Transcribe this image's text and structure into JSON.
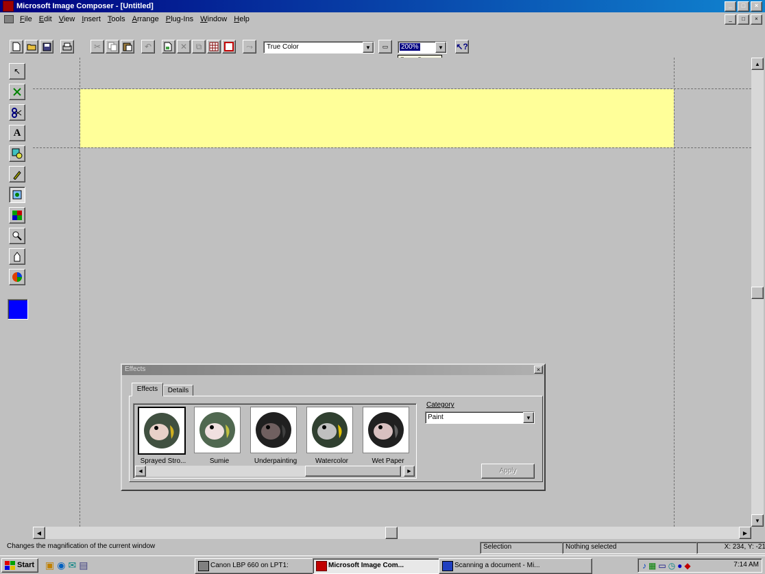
{
  "window": {
    "title": "Microsoft Image Composer - [Untitled]",
    "caption_buttons": [
      "_",
      "□",
      "×"
    ]
  },
  "menu": [
    "File",
    "Edit",
    "View",
    "Insert",
    "Tools",
    "Arrange",
    "Plug-Ins",
    "Window",
    "Help"
  ],
  "toolbar": {
    "color_format": "True Color",
    "zoom_value": "200%",
    "zoom_tooltip": "Zoom Percent"
  },
  "toolbox": {
    "tools": [
      "arrow-icon",
      "arrange-icon",
      "cutout-icon",
      "text-icon",
      "shapes-icon",
      "paint-icon",
      "effects-icon",
      "texture-icon",
      "zoom-icon",
      "pan-icon",
      "color-tuning-icon"
    ],
    "current_color": "#0000ff"
  },
  "effects_dialog": {
    "title": "Effects",
    "tabs": [
      "Effects",
      "Details"
    ],
    "items": [
      {
        "label": "Sprayed Stro..."
      },
      {
        "label": "Sumie"
      },
      {
        "label": "Underpainting"
      },
      {
        "label": "Watercolor"
      },
      {
        "label": "Wet Paper"
      }
    ],
    "category_label": "Category",
    "category_value": "Paint",
    "apply_label": "Apply"
  },
  "statusbar": {
    "hint": "Changes the magnification of the current window",
    "mode": "Selection",
    "selection": "Nothing selected",
    "coords": "X: 234, Y: -21"
  },
  "taskbar": {
    "start_label": "Start",
    "tasks": [
      {
        "label": "Canon LBP 660 on LPT1:"
      },
      {
        "label": "Microsoft Image Com..."
      },
      {
        "label": "Scanning a document - Mi..."
      }
    ],
    "clock": "7:14 AM"
  },
  "colors": {
    "title_start": "#000080",
    "title_end": "#1084d0",
    "banner": "#ffff99",
    "desktop_gray": "#c0c0c0"
  }
}
